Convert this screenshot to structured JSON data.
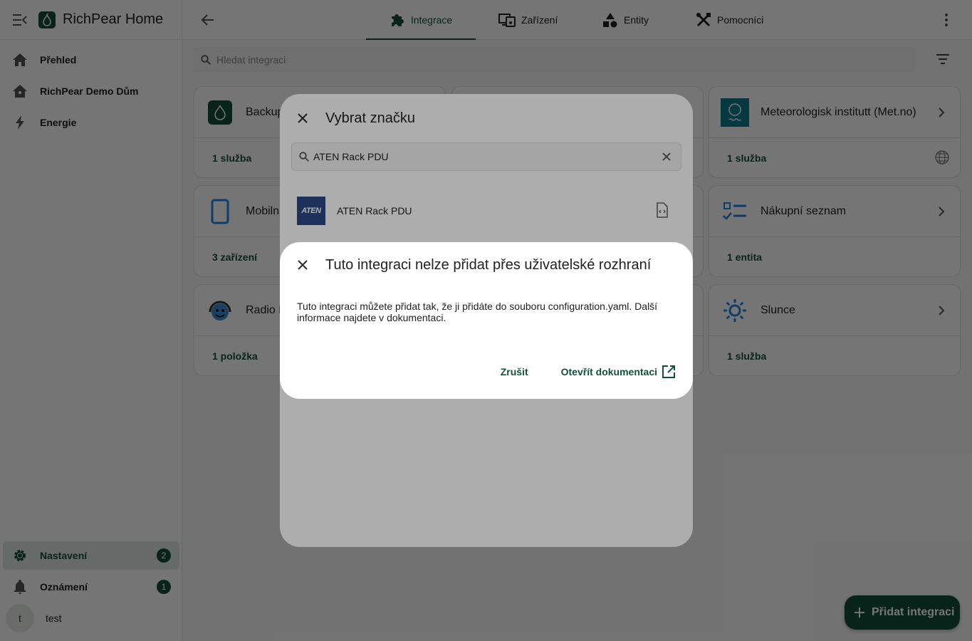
{
  "app": {
    "title": "RichPear Home"
  },
  "sidebar": {
    "items": [
      {
        "label": "Přehled",
        "icon": "home-icon"
      },
      {
        "label": "RichPear Demo Dům",
        "icon": "home-assistant-icon"
      },
      {
        "label": "Energie",
        "icon": "lightning-icon"
      }
    ],
    "settings": {
      "label": "Nastavení",
      "badge": "2"
    },
    "notifications": {
      "label": "Oznámení",
      "badge": "1"
    },
    "user": {
      "initial": "t",
      "name": "test"
    }
  },
  "tabs": [
    {
      "label": "Integrace",
      "active": true
    },
    {
      "label": "Zařízení"
    },
    {
      "label": "Entity"
    },
    {
      "label": "Pomocníci"
    }
  ],
  "search": {
    "placeholder": "Hledat integraci"
  },
  "cards": [
    {
      "name": "Backup",
      "count": "1 služba"
    },
    {
      "name": "Meteorologisk institutt (Met.no)",
      "count": "1 služba"
    },
    {
      "name": "Mobiln",
      "count": "3 zařízení"
    },
    {
      "name": "Nákupní seznam",
      "count": "1 entita"
    },
    {
      "name": "Radio B",
      "count": "1 položka"
    },
    {
      "name": "Slunce",
      "count": "1 služba"
    }
  ],
  "fab": {
    "label": "Přidat integraci"
  },
  "brand_dialog": {
    "title": "Vybrat značku",
    "search_value": "ATEN Rack PDU",
    "results": [
      {
        "name": "ATEN Rack PDU",
        "logo_text": "ATEN"
      }
    ]
  },
  "info_dialog": {
    "title": "Tuto integraci nelze přidat přes uživatelské rozhraní",
    "body": "Tuto integraci můžete přidat tak, že ji přidáte do souboru configuration.yaml. Další informace najdete v dokumentaci.",
    "cancel_label": "Zrušit",
    "docs_label": "Otevřít dokumentaci"
  },
  "colors": {
    "primary": "#13503a",
    "accent_card": "#0f7e8e"
  }
}
